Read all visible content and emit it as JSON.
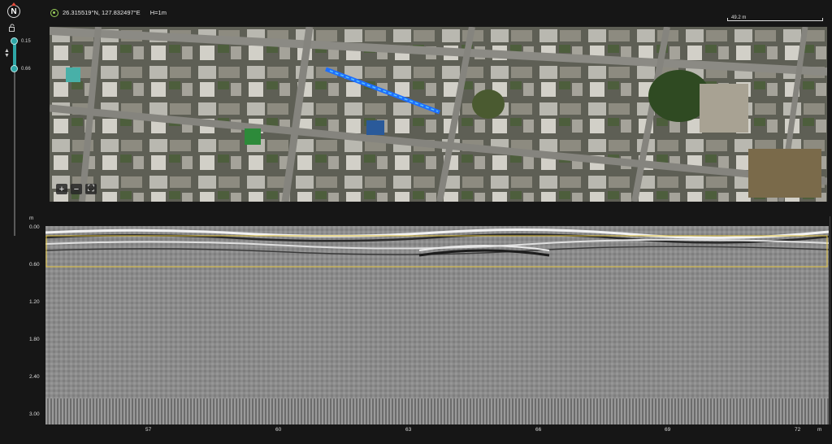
{
  "sidebar": {
    "compass_label": "N",
    "slider_top_value": "0.15",
    "slider_bottom_value": "0.66"
  },
  "topbar": {
    "coordinates": "26.315519°N, 127.832497°E",
    "height": "H=1m",
    "scale_label": "49.2 m"
  },
  "map": {
    "zoom_in": "+",
    "zoom_out": "−",
    "fit": "⛶",
    "track_color": "#1e6fff"
  },
  "radargram": {
    "y_unit": "m",
    "x_unit": "m",
    "depth_ticks": [
      "0.00",
      "0.60",
      "1.20",
      "1.80",
      "2.40",
      "3.00"
    ],
    "distance_ticks": [
      "57",
      "60",
      "63",
      "66",
      "69",
      "72"
    ],
    "highlight_color": "#e0c23c"
  }
}
